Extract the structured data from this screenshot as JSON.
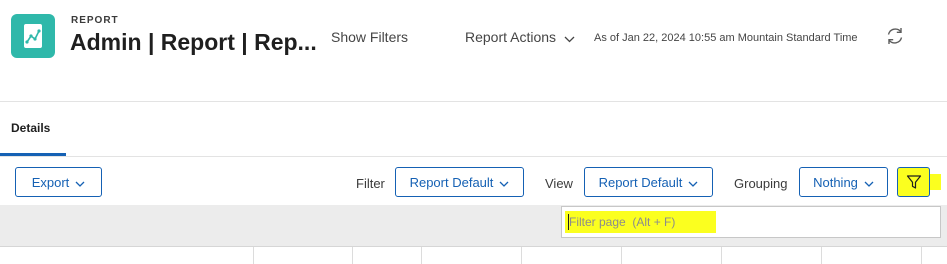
{
  "header": {
    "eyebrow": "REPORT",
    "title": "Admin | Report | Rep...",
    "show_filters": "Show Filters",
    "report_actions": "Report Actions",
    "as_of": "As of Jan 22, 2024 10:55 am Mountain Standard Time",
    "icons": [
      "report-icon",
      "chevron-down-icon",
      "refresh-icon"
    ]
  },
  "tabs": [
    {
      "label": "Details",
      "active": true
    }
  ],
  "toolbar": {
    "export_label": "Export",
    "filter_label": "Filter",
    "filter_value": "Report Default",
    "view_label": "View",
    "view_value": "Report Default",
    "grouping_label": "Grouping",
    "grouping_value": "Nothing",
    "filter_toggle_icon": "funnel-icon"
  },
  "filter_page": {
    "placeholder": "Filter page  (Alt + F)",
    "value": ""
  },
  "colors": {
    "accent": "#1561b4",
    "app_icon": "#2fb8aa",
    "highlight": "#fbff1f",
    "band": "#ececec"
  }
}
